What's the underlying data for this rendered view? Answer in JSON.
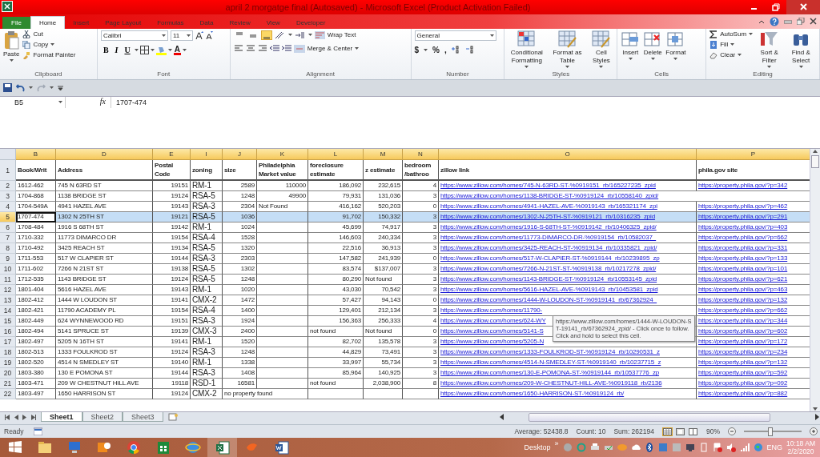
{
  "window": {
    "title": "april 2 morgatge final (Autosaved) - Microsoft Excel (Product Activation Failed)"
  },
  "tabs": [
    {
      "label": "File",
      "kind": "file",
      "selected": false
    },
    {
      "label": "Home",
      "kind": "tab",
      "selected": true
    },
    {
      "label": "Insert",
      "kind": "tab",
      "selected": false
    },
    {
      "label": "Page Layout",
      "kind": "tab",
      "selected": false
    },
    {
      "label": "Formulas",
      "kind": "tab",
      "selected": false
    },
    {
      "label": "Data",
      "kind": "tab",
      "selected": false
    },
    {
      "label": "Review",
      "kind": "tab",
      "selected": false
    },
    {
      "label": "View",
      "kind": "tab",
      "selected": false
    },
    {
      "label": "Developer",
      "kind": "tab",
      "selected": false
    }
  ],
  "ribbon": {
    "groups": [
      {
        "kind": "clipboard",
        "label": "Clipboard",
        "paste": "Paste",
        "items": [
          "Cut",
          "Copy",
          "Format Painter"
        ]
      },
      {
        "kind": "font",
        "label": "Font",
        "font_name": "Calibri",
        "font_size": "11",
        "styles": [
          "B",
          "I",
          "U"
        ],
        "font_color": "A"
      },
      {
        "kind": "alignment",
        "label": "Alignment",
        "vertical_align": [
          {
            "selected": false
          },
          {
            "selected": false
          },
          {
            "selected": true
          }
        ],
        "wrap": "Wrap Text",
        "merge": "Merge & Center"
      },
      {
        "kind": "number",
        "label": "Number",
        "format": "General",
        "symbols": [
          "$",
          "%",
          ","
        ]
      },
      {
        "kind": "styles",
        "label": "Styles",
        "items": [
          "Conditional Formatting",
          "Format as Table",
          "Cell Styles"
        ]
      },
      {
        "kind": "cells",
        "label": "Cells",
        "items": [
          "Insert",
          "Delete",
          "Format"
        ]
      },
      {
        "kind": "editing",
        "label": "Editing",
        "small": [
          "AutoSum",
          "Fill",
          "Clear"
        ],
        "large": [
          "Sort & Filter",
          "Find & Select"
        ]
      }
    ]
  },
  "formula_bar": {
    "name_box": "B5",
    "function_label": "fx",
    "value": "1707-474"
  },
  "sheet": {
    "columns": [
      {
        "letter": "B",
        "header": "Book/Writ",
        "kind": "text"
      },
      {
        "letter": "D",
        "header": "Address",
        "kind": "text"
      },
      {
        "letter": "E",
        "header": "Postal Code",
        "kind": "text"
      },
      {
        "letter": "I",
        "header": "zoning",
        "kind": "large"
      },
      {
        "letter": "J",
        "header": "size",
        "kind": "text"
      },
      {
        "letter": "K",
        "header": "Philadelphia Market value",
        "kind": "text"
      },
      {
        "letter": "L",
        "header": "foreclosure estimate",
        "kind": "text"
      },
      {
        "letter": "M",
        "header": "z estimate",
        "kind": "text"
      },
      {
        "letter": "N",
        "header": "bedroom /bathroo",
        "kind": "text"
      },
      {
        "letter": "O",
        "header": "zillow link",
        "kind": "link"
      },
      {
        "letter": "P",
        "header": "phila.gov site",
        "kind": "link"
      }
    ],
    "header_row": "1",
    "rows": [
      {
        "number": "2",
        "selected": false,
        "cells": {
          "B": "1612-462",
          "D": "745 N 63RD ST",
          "E": "19151",
          "I": "RM-1",
          "J": "2589",
          "K": "110000",
          "L": "186,092",
          "M": "232,615",
          "N": "4",
          "O": "https://www.zillow.com/homes/745-N-63RD-ST-%0919151_rb/165227235_zpid",
          "P": "https://property.phila.gov/?p=342"
        }
      },
      {
        "number": "3",
        "selected": false,
        "cells": {
          "B": "1704-868",
          "D": "1138 BRIDGE ST",
          "E": "19124",
          "I": "RSA-5",
          "J": "1248",
          "K": "49900",
          "L": "79,931",
          "M": "131,036",
          "N": "3",
          "O": "https://www.zillow.com/homes/1138-BRIDGE-ST-%0919124_rb/10558140_zpid/"
        }
      },
      {
        "number": "4",
        "selected": false,
        "cells": {
          "B": "1704-549A",
          "D": "4941 HAZEL AVE",
          "E": "19143",
          "I": "RSA-3",
          "J": "2304",
          "K": "Not Found",
          "L": "416,162",
          "M": "520,203",
          "N": "0",
          "O": "https://www.zillow.com/homes/4941-HAZEL-AVE-%0919143_rb/165321174_zpi",
          "P": "https://property.phila.gov/?p=462"
        }
      },
      {
        "number": "5",
        "selected": true,
        "cells": {
          "B": "1707-474",
          "D": "1302 N 25TH ST",
          "E": "19121",
          "I": "RSA-5",
          "J": "1036",
          "L": "91,702",
          "M": "150,332",
          "N": "3",
          "O": "https://www.zillow.com/homes/1302-N-25TH-ST-%0919121_rb/10316235_zpid",
          "P": "https://property.phila.gov/?p=291"
        }
      },
      {
        "number": "6",
        "selected": false,
        "cells": {
          "B": "1708-484",
          "D": "1916 S 68TH ST",
          "E": "19142",
          "I": "RM-1",
          "J": "1024",
          "L": "45,699",
          "M": "74,917",
          "N": "3",
          "O": "https://www.zillow.com/homes/1916-S-68TH-ST-%0919142_rb/10406325_zpid/",
          "P": "https://property.phila.gov/?p=403"
        }
      },
      {
        "number": "7",
        "selected": false,
        "cells": {
          "B": "1710-332",
          "D": "11773 DIMARCO DR",
          "E": "19154",
          "I": "RSA-4",
          "J": "1528",
          "L": "146,603",
          "M": "240,334",
          "N": "3",
          "O": "https://www.zillow.com/homes/11773-DIMARCO-DR-%0919154_rb/10582037_",
          "P": "https://property.phila.gov/?p=662"
        }
      },
      {
        "number": "8",
        "selected": false,
        "cells": {
          "B": "1710-492",
          "D": "3425 REACH ST",
          "E": "19134",
          "I": "RSA-5",
          "J": "1320",
          "L": "22,516",
          "M": "36,913",
          "N": "3",
          "O": "https://www.zillow.com/homes/3425-REACH-ST-%0919134_rb/10335821_zpid/",
          "P": "https://property.phila.gov/?p=331"
        }
      },
      {
        "number": "9",
        "selected": false,
        "cells": {
          "B": "1711-553",
          "D": "517 W CLAPIER ST",
          "E": "19144",
          "I": "RSA-3",
          "J": "2303",
          "L": "147,582",
          "M": "241,939",
          "N": "0",
          "O": "https://www.zillow.com/homes/517-W-CLAPIER-ST-%0919144_rb/10239895_zp",
          "P": "https://property.phila.gov/?p=133"
        }
      },
      {
        "number": "10",
        "selected": false,
        "cells": {
          "B": "1711-602",
          "D": "7266 N 21ST ST",
          "E": "19138",
          "I": "RSA-5",
          "J": "1302",
          "L": "83,574",
          "M": "$137,007",
          "N": "3",
          "O": "https://www.zillow.com/homes/7266-N-21ST-ST-%0919138_rb/10217278_zpid/",
          "P": "https://property.phila.gov/?p=101"
        }
      },
      {
        "number": "11",
        "selected": false,
        "cells": {
          "B": "1712-535",
          "D": "1143 BRIDGE ST",
          "E": "19124",
          "I": "RSA-5",
          "J": "1248",
          "L": "80,290",
          "M": "Not found",
          "N": "3",
          "O": "https://www.zillow.com/homes/1143-BRIDGE-ST-%0919124_rb/10553145_zpid",
          "P": "https://property.phila.gov/?p=621"
        }
      },
      {
        "number": "12",
        "selected": false,
        "cells": {
          "B": "1801-404",
          "D": "5616 HAZEL AVE",
          "E": "19143",
          "I": "RM-1",
          "J": "1020",
          "L": "43,030",
          "M": "70,542",
          "N": "3",
          "O": "https://www.zillow.com/homes/5616-HAZEL-AVE-%0919143_rb/10453581_zpid",
          "P": "https://property.phila.gov/?p=463"
        }
      },
      {
        "number": "13",
        "selected": false,
        "cells": {
          "B": "1802-412",
          "D": "1444 W LOUDON ST",
          "E": "19141",
          "I": "CMX-2",
          "J": "1472",
          "L": "57,427",
          "M": "94,143",
          "N": "0",
          "O": "https://www.zillow.com/homes/1444-W-LOUDON-ST-%0919141_rb/67362924_",
          "P": "https://property.phila.gov/?p=132"
        }
      },
      {
        "number": "14",
        "selected": false,
        "cells": {
          "B": "1802-421",
          "D": "11790 ACADEMY PL",
          "E": "19154",
          "I": "RSA-4",
          "J": "1400",
          "L": "129,401",
          "M": "212,134",
          "N": "3",
          "O": "https://www.zillow.com/homes/11790-",
          "P": "https://property.phila.gov/?p=662"
        }
      },
      {
        "number": "15",
        "selected": false,
        "cells": {
          "B": "1802-449",
          "D": "624 WYNNEWOOD RD",
          "E": "19151",
          "I": "RSA-3",
          "J": "1924",
          "L": "156,363",
          "M": "256,333",
          "N": "4",
          "O": "https://www.zillow.com/homes/624-WY",
          "P": "https://property.phila.gov/?p=344"
        }
      },
      {
        "number": "16",
        "selected": false,
        "cells": {
          "B": "1802-494",
          "D": "5141 SPRUCE ST",
          "E": "19139",
          "I": "CMX-3",
          "J": "2400",
          "L": "not found",
          "M": "Not found",
          "N": "0",
          "O": "https://www.zillow.com/homes/5141-S",
          "P": "https://property.phila.gov/?p=602"
        }
      },
      {
        "number": "17",
        "selected": false,
        "cells": {
          "B": "1802-497",
          "D": "5205 N 16TH ST",
          "E": "19141",
          "I": "RM-1",
          "J": "1520",
          "L": "82,702",
          "M": "135,578",
          "N": "3",
          "O": "https://www.zillow.com/homes/5205-N",
          "P": "https://property.phila.gov/?p=172"
        }
      },
      {
        "number": "18",
        "selected": false,
        "cells": {
          "B": "1802-513",
          "D": "1333 FOULKROD ST",
          "E": "19124",
          "I": "RSA-3",
          "J": "1248",
          "L": "44,829",
          "M": "73,491",
          "N": "3",
          "O": "https://www.zillow.com/homes/1333-FOULKROD-ST-%0919124_rb/10290531_z",
          "P": "https://property.phila.gov/?p=234"
        }
      },
      {
        "number": "19",
        "selected": false,
        "cells": {
          "B": "1802-520",
          "D": "4514 N SMEDLEY ST",
          "E": "19140",
          "I": "RM-1",
          "J": "1338",
          "L": "33,997",
          "M": "55,734",
          "N": "3",
          "O": "https://www.zillow.com/homes/4514-N-SMEDLEY-ST-%0919140_rb/10237715_z",
          "P": "https://property.phila.gov/?p=132"
        }
      },
      {
        "number": "20",
        "selected": false,
        "cells": {
          "B": "1803-380",
          "D": "130 E POMONA ST",
          "E": "19144",
          "I": "RSA-3",
          "J": "1408",
          "L": "85,964",
          "M": "140,925",
          "N": "3",
          "O": "https://www.zillow.com/homes/130-E-POMONA-ST-%0919144_rb/10537776_zp",
          "P": "https://property.phila.gov/?p=592"
        }
      },
      {
        "number": "21",
        "selected": false,
        "cells": {
          "B": "1803-471",
          "D": "209 W CHESTNUT HILL AVE",
          "E": "19118",
          "I": "RSD-1",
          "J": "16581",
          "L": "not found",
          "M": "2,038,900",
          "N": "8",
          "O": "https://www.zillow.com/homes/209-W-CHESTNUT-HILL-AVE-%0919118_rb/2136",
          "P": "https://property.phila.gov/?p=092"
        }
      },
      {
        "number": "22",
        "selected": false,
        "cells": {
          "B": "1803-497",
          "D": "1650 HARRISON ST",
          "E": "19124",
          "I": "CMX-2",
          "J": "no property found",
          "O": "https://www.zillow.com/homes/1650-HARRISON-ST-%0919124_rb/",
          "P": "https://property.phila.gov/?p=882"
        }
      }
    ],
    "tooltip": "https://www.zillow.com/homes/1444-W-LOUDON-ST-19141_rb/67362924_zpid/ - Click once to follow. Click and hold to select this cell."
  },
  "sheet_tabs": [
    {
      "label": "Sheet1",
      "selected": true
    },
    {
      "label": "Sheet2",
      "selected": false
    },
    {
      "label": "Sheet3",
      "selected": false
    }
  ],
  "status_bar": {
    "mode": "Ready",
    "average": "Average: 52438.8",
    "count": "Count: 10",
    "sum": "Sum: 262194",
    "zoom": "90%",
    "zoom_slider": {
      "level": 0.45
    }
  },
  "taskbar": {
    "desktop": "Desktop",
    "more": "»",
    "language": "ENG",
    "time": "10:18 AM",
    "date": "2/2/2020"
  }
}
